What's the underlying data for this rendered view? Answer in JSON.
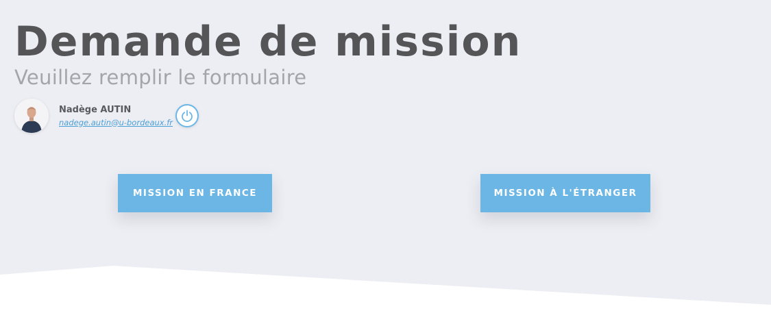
{
  "header": {
    "title": "Demande de mission",
    "subtitle": "Veuillez remplir le formulaire"
  },
  "user": {
    "name": "Nadège AUTIN",
    "email": "nadege.autin@u-bordeaux.fr"
  },
  "actions": {
    "mission_france_label": "Mission en France",
    "mission_etranger_label": "Mission à l'étranger"
  },
  "icons": {
    "logout": "power-icon",
    "avatar": "user-photo"
  },
  "colors": {
    "background": "#edeef3",
    "accent": "#6bb6e4",
    "title": "#555558",
    "subtitle": "#a4a5aa",
    "link": "#4a9fd6"
  }
}
